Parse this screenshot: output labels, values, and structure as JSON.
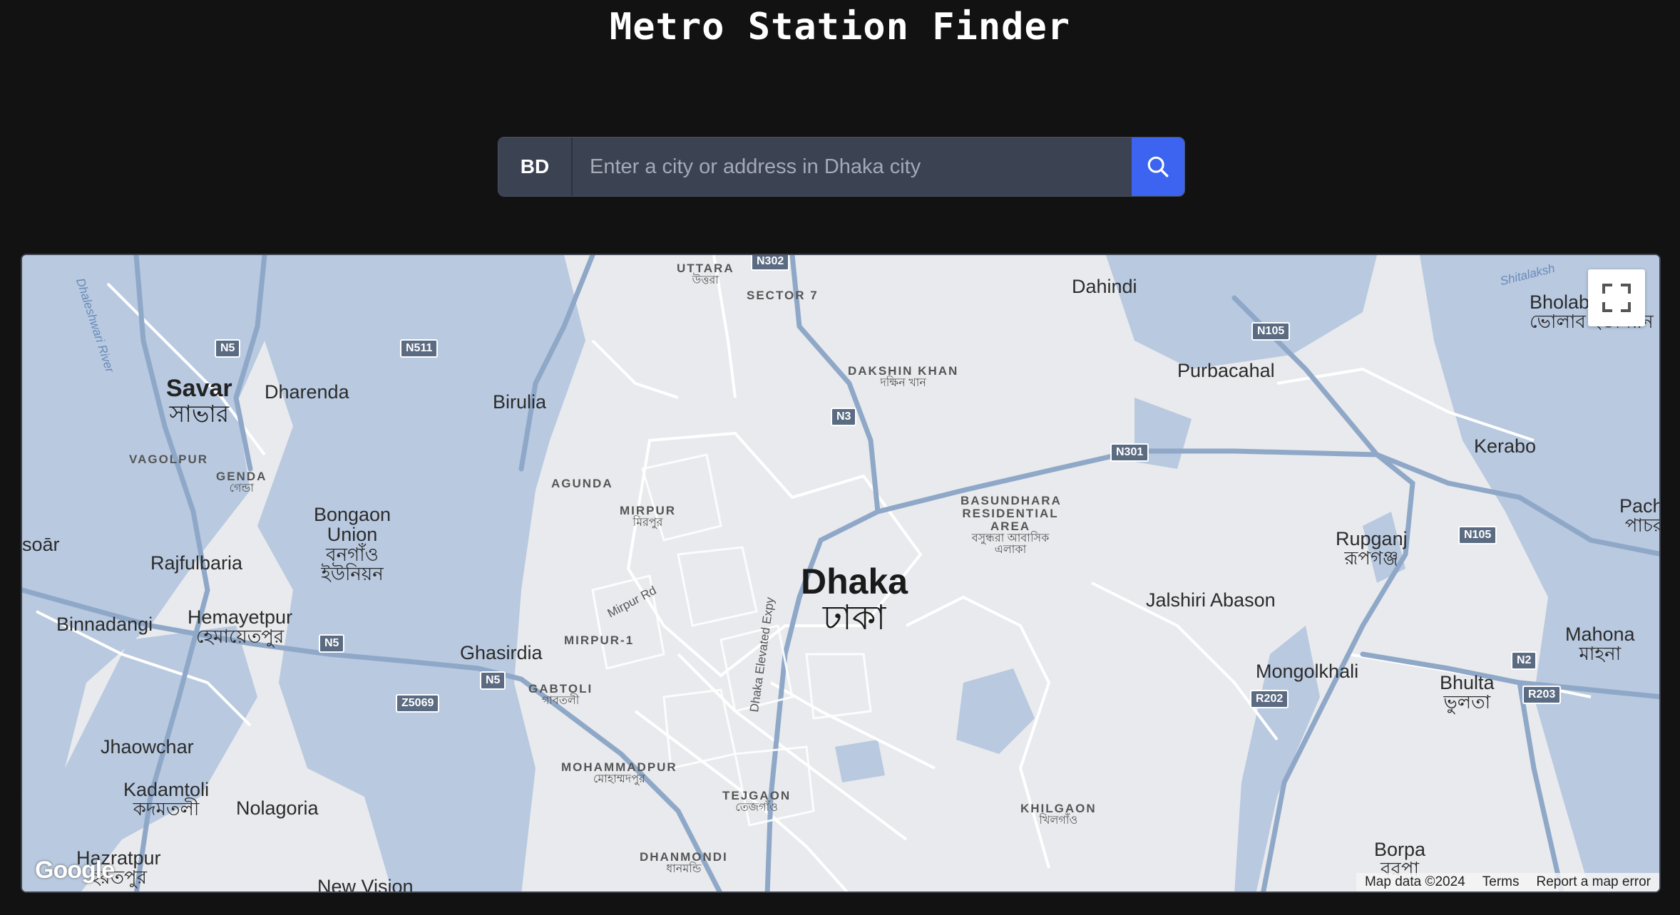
{
  "title": "Metro Station Finder",
  "search": {
    "country_code": "BD",
    "placeholder": "Enter a city or address in Dhaka city",
    "value": ""
  },
  "map": {
    "labels": {
      "uttara": {
        "en": "UTTARA",
        "bn": "উত্তরা"
      },
      "sector7": {
        "en": "SECTOR 7"
      },
      "dahindi": {
        "en": "Dahindi"
      },
      "dakshin_khan": {
        "en": "DAKSHIN KHAN",
        "bn": "দক্ষিন খান"
      },
      "purbacahal": {
        "en": "Purbacahal"
      },
      "bholab": {
        "en": "Bholab Union",
        "bn": "ভোলাব ইউনিয়ন"
      },
      "savar": {
        "en": "Savar",
        "bn": "সাভার"
      },
      "dharenda": {
        "en": "Dharenda"
      },
      "birulia": {
        "en": "Birulia"
      },
      "kerabo": {
        "en": "Kerabo"
      },
      "vagolpur": {
        "en": "VAGOLPUR"
      },
      "genda": {
        "en": "GENDA",
        "bn": "গেন্ডা"
      },
      "agunda": {
        "en": "AGUNDA"
      },
      "mirpur": {
        "en": "MIRPUR",
        "bn": "মিরপুর"
      },
      "basundhara": {
        "en": "BASUNDHARA RESIDENTIAL AREA",
        "bn": "বসুন্ধরা আবাসিক এলাকা"
      },
      "pachruk": {
        "en": "Pachruk",
        "bn": "পাচরুখী"
      },
      "bongaon": {
        "en": "Bongaon Union",
        "bn": "বনগাঁও ইউনিয়ন"
      },
      "rupganj": {
        "en": "Rupganj",
        "bn": "রূপগঞ্জ"
      },
      "soar": {
        "en": "soār"
      },
      "rajfulbaria": {
        "en": "Rajfulbaria"
      },
      "dhaka": {
        "en": "Dhaka",
        "bn": "ঢাকা"
      },
      "jalshiri": {
        "en": "Jalshiri Abason"
      },
      "binnadangi": {
        "en": "Binnadangi"
      },
      "hemayetpur": {
        "en": "Hemayetpur",
        "bn": "হেমায়েতপুর"
      },
      "mirpur_rd": {
        "en": "Mirpur Rd"
      },
      "mahona": {
        "en": "Mahona",
        "bn": "মাহনা"
      },
      "ghasirdia": {
        "en": "Ghasirdia"
      },
      "mirpur1": {
        "en": "MIRPUR-1"
      },
      "mongolkhali": {
        "en": "Mongolkhali"
      },
      "bhulta": {
        "en": "Bhulta",
        "bn": "ভুলতা"
      },
      "gabtoli": {
        "en": "GABTOLI",
        "bn": "গাবতলী"
      },
      "elevated": {
        "en": "Dhaka Elevated Expy"
      },
      "jhaowchar": {
        "en": "Jhaowchar"
      },
      "mohammadpur": {
        "en": "MOHAMMADPUR",
        "bn": "মোহাম্মদপুর"
      },
      "kadamtoli": {
        "en": "Kadamtoli",
        "bn": "কদমতলী"
      },
      "tejgaon": {
        "en": "TEJGAON",
        "bn": "তেজগাঁও"
      },
      "nolagoria": {
        "en": "Nolagoria"
      },
      "khilgaon": {
        "en": "KHILGAON",
        "bn": "খিলগাঁও"
      },
      "hazratpur": {
        "en": "Hazratpur",
        "bn": "হরতপুর"
      },
      "dhanmondi": {
        "en": "DHANMONDI",
        "bn": "ধানমন্ডি"
      },
      "borpa": {
        "en": "Borpa",
        "bn": "বরপা"
      },
      "new_vision": {
        "en": "New Vision"
      },
      "dhaleshwari": {
        "en": "Dhaleshwari River"
      },
      "shitalaksh": {
        "en": "Shitalaksh"
      }
    },
    "shields": [
      "N302",
      "N5",
      "N511",
      "N3",
      "N105",
      "N301",
      "N105",
      "N5",
      "N5",
      "Z5069",
      "N2",
      "R202",
      "R203"
    ],
    "attribution": {
      "map_data": "Map data ©2024",
      "terms": "Terms",
      "report": "Report a map error"
    },
    "logo": "Google",
    "colors": {
      "water": "#b8c9e0",
      "land": "#e8eaed",
      "road": "#ffffff",
      "highway": "#8fa8c8"
    }
  }
}
